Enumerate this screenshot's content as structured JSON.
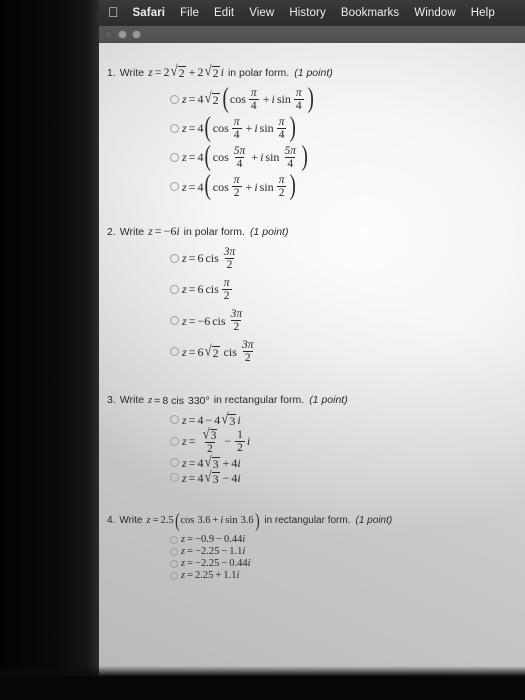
{
  "menubar": {
    "apple_icon": "apple-icon",
    "items": [
      {
        "label": "Safari",
        "bold": true
      },
      {
        "label": "File",
        "bold": false
      },
      {
        "label": "Edit",
        "bold": false
      },
      {
        "label": "View",
        "bold": false
      },
      {
        "label": "History",
        "bold": false
      },
      {
        "label": "Bookmarks",
        "bold": false
      },
      {
        "label": "Window",
        "bold": false
      },
      {
        "label": "Help",
        "bold": false
      }
    ]
  },
  "window_controls": {
    "close": "close-button",
    "minimize": "minimize-button",
    "zoom": "zoom-button"
  },
  "quiz": {
    "questions": [
      {
        "number": "1.",
        "verb": "Write",
        "stem_plain": "z = 2√2 + 2√2i",
        "tail": "in polar form.",
        "points": "(1 point)",
        "options": [
          {
            "plain": "z = 4√2(cos π/4 + i sin π/4)"
          },
          {
            "plain": "z = 4(cos π/4 + i sin π/4)"
          },
          {
            "plain": "z = 4(cos 5π/4 + i sin 5π/4)"
          },
          {
            "plain": "z = 4(cos π/2 + i sin π/2)"
          }
        ]
      },
      {
        "number": "2.",
        "verb": "Write",
        "stem_plain": "z = −6i",
        "tail": "in polar form.",
        "points": "(1 point)",
        "options": [
          {
            "plain": "z = 6 cis 3π/2"
          },
          {
            "plain": "z = 6 cis π/2"
          },
          {
            "plain": "z = −6 cis 3π/2"
          },
          {
            "plain": "z = 6√2 cis 3π/2"
          }
        ]
      },
      {
        "number": "3.",
        "verb": "Write",
        "stem_plain": "z = 8 cis 330°",
        "tail": "in rectangular form.",
        "points": "(1 point)",
        "options": [
          {
            "plain": "z = 4 − 4√3i"
          },
          {
            "plain": "z = √3/2 − 1/2 i"
          },
          {
            "plain": "z = 4√3 + 4i"
          },
          {
            "plain": "z = 4√3 − 4i"
          }
        ]
      },
      {
        "number": "4.",
        "verb": "Write",
        "stem_plain": "z = 2.5(cos 3.6 + i sin 3.6)",
        "tail": "in rectangular form.",
        "points": "(1 point)",
        "options": [
          {
            "plain": "z = −0.9 − 0.44i"
          },
          {
            "plain": "z = −2.25 − 1.1i"
          },
          {
            "plain": "z = −2.25 − 0.44i"
          },
          {
            "plain": "z = 2.25 + 1.1i"
          }
        ]
      }
    ]
  },
  "math_tokens": {
    "z": "z",
    "eq": "=",
    "plus": "+",
    "minus": "−",
    "i": "i",
    "cos": "cos",
    "sin": "sin",
    "cis": "cis",
    "pi": "π",
    "radical": "√",
    "two": "2",
    "three": "3",
    "four": "4",
    "five": "5",
    "six": "6",
    "eight": "8",
    "deg330": "330°",
    "two_point_five": "2.5",
    "three_point_six": "3.6",
    "v0_9": "0.9",
    "v0_44": "0.44",
    "v2_25": "2.25",
    "v1_1": "1.1",
    "five_pi": "5π",
    "three_pi": "3π"
  },
  "colors": {
    "menubar_bg": "#343434",
    "menubar_text": "#ededed",
    "chrome_bg": "#555555",
    "page_bg": "#f3f3f3",
    "text": "#2b2b2b",
    "radio_border": "#9e9e9e",
    "photo_border": "#050505"
  }
}
